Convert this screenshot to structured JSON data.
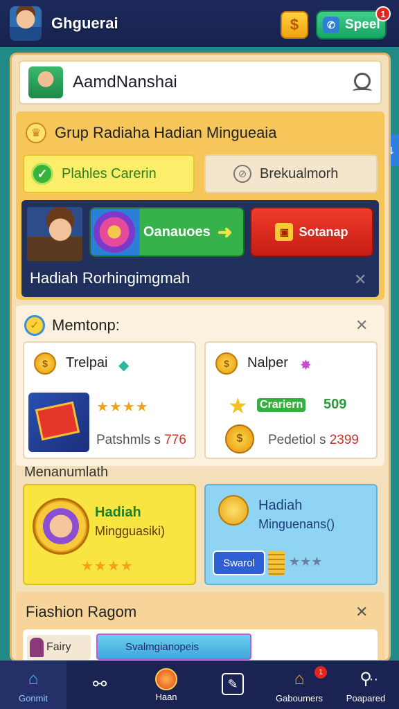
{
  "header": {
    "title": "Ghguerai",
    "coin_glyph": "$",
    "speed_label": "Speel",
    "speed_badge": "1"
  },
  "search": {
    "value": "AamdNanshai"
  },
  "group": {
    "title": "Grup Radiaha Hadian Mingueaia",
    "chip_active": "Plahles Carerin",
    "chip_inactive": "Brekualmorh",
    "play_label": "Oanauoes",
    "red_label": "Sotanap",
    "caption": "Hadiah Rorhingimgmah"
  },
  "member": {
    "title": "Memtonp:",
    "card_left": {
      "name": "Trelpai",
      "coin_glyph": "$",
      "stars": "★★★★",
      "stat_label": "Patshmls",
      "stat_value": "776"
    },
    "card_right": {
      "name": "Nalper",
      "coin_glyph": "$",
      "badge": "Crariern",
      "badge_number": "509",
      "stat_label": "Pedetiol",
      "stat_value": "2399"
    }
  },
  "rewards": {
    "section_label": "Menanumlath",
    "left": {
      "title": "Hadiah",
      "subtitle": "Mingguasiki)",
      "stars": "★★★★"
    },
    "right": {
      "title": "Hadiah",
      "subtitle": "Minguenans()",
      "button": "Swarol",
      "dots": "★★★"
    }
  },
  "fashion": {
    "title": "Fiashion Ragom",
    "item_label": "Fairy",
    "bar_label": "Svalmgianopeis"
  },
  "nav": {
    "items": [
      {
        "label": "Gonmit",
        "icon": "home-icon"
      },
      {
        "label": "",
        "icon": "link-icon"
      },
      {
        "label": "Haan",
        "icon": "ball-icon"
      },
      {
        "label": "",
        "icon": "edit-icon"
      },
      {
        "label": "Gaboumers",
        "icon": "house-icon",
        "badge": "1"
      },
      {
        "label": "Poapared",
        "icon": "search-icon"
      }
    ]
  },
  "colors": {
    "background": "#1f8a86",
    "topbar": "#1c2a5c",
    "panel": "#f3dfb9",
    "accent_yellow": "#f6c65a",
    "accent_green": "#37b24a",
    "accent_red": "#e2251f"
  }
}
